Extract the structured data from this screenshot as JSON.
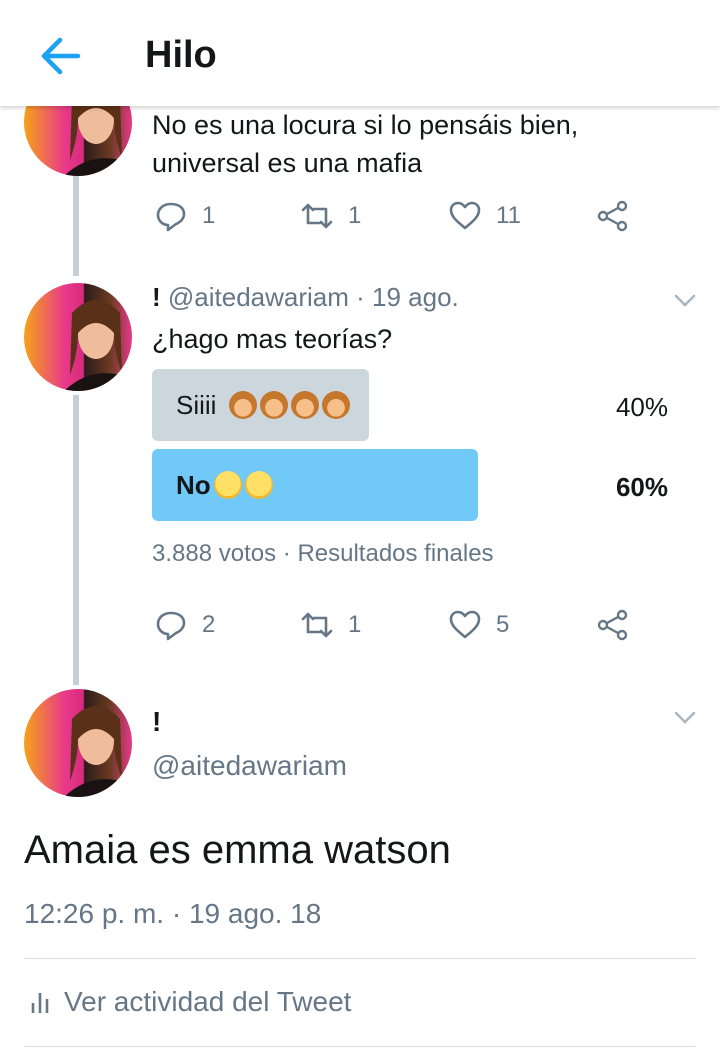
{
  "header": {
    "title": "Hilo"
  },
  "tweet1": {
    "text_line1": "No es una locura si lo pensáis bien,",
    "text_line2": "universal es una mafia",
    "replies": "1",
    "retweets": "1",
    "likes": "11"
  },
  "tweet2": {
    "name": "!",
    "handle_date": "@aitedawariam · 19 ago.",
    "text": "¿hago mas teorías?",
    "poll": {
      "options": [
        {
          "label": "Siiii",
          "percent": "40%",
          "fraction": 0.4,
          "emoji": [
            "see-no-evil-monkey",
            "see-no-evil-monkey",
            "see-no-evil-monkey",
            "see-no-evil-monkey"
          ]
        },
        {
          "label": "No",
          "percent": "60%",
          "fraction": 0.6,
          "emoji": [
            "unamused-face",
            "unamused-face"
          ]
        }
      ],
      "votes": "3.888 votos",
      "status": "Resultados finales"
    },
    "replies": "2",
    "retweets": "1",
    "likes": "5"
  },
  "tweet3": {
    "name": "!",
    "handle": "@aitedawariam",
    "text": "Amaia es emma watson",
    "timestamp": "12:26 p. m. · 19 ago. 18",
    "activity": "Ver actividad del Tweet"
  },
  "colors": {
    "accent": "#1da1f2",
    "poll_winner": "#71c9f8",
    "poll_loser": "#ccd6dd",
    "secondary_text": "#657786",
    "thread_line": "#c4cfd6"
  }
}
